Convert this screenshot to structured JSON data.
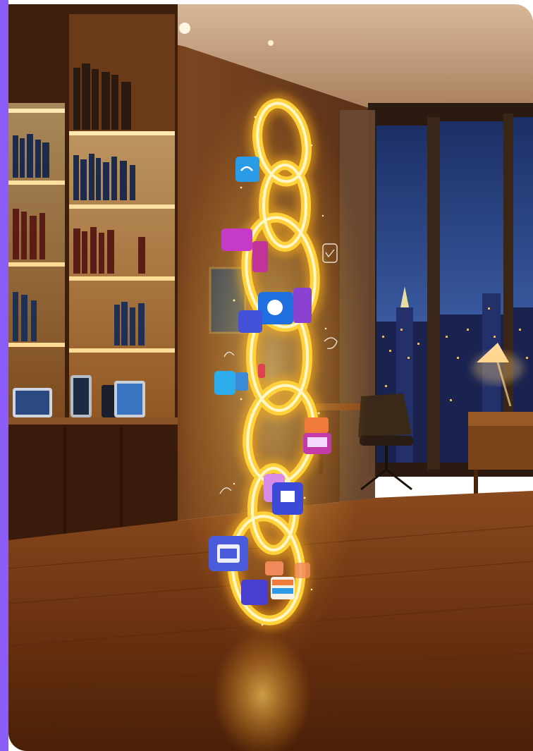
{
  "colors": {
    "accent": "#8b5cf6",
    "page_background": "#ffffff",
    "chain_glow": "#ffd23c",
    "wall": "#6e3d1c",
    "floor": "#7a3a16",
    "night_sky": "#1c2f66"
  },
  "image": {
    "subject_icon": "glowing-chain-with-app-icons-illustration"
  }
}
